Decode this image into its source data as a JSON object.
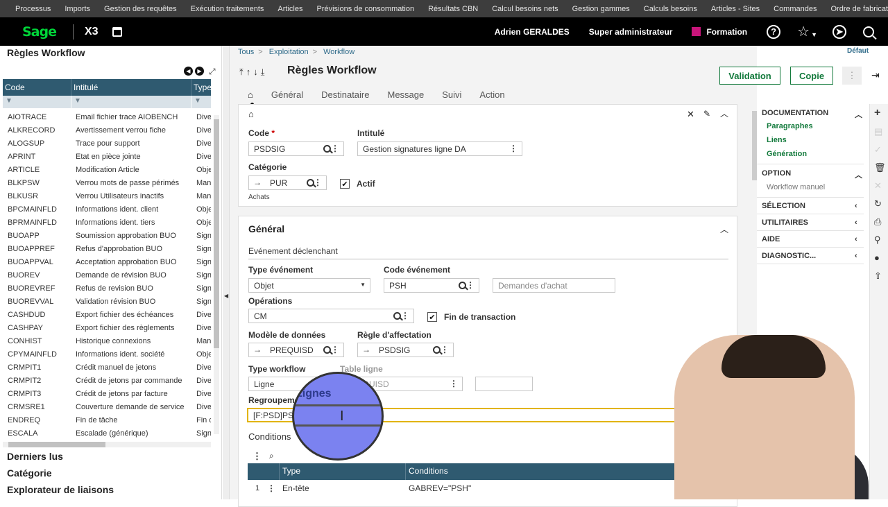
{
  "topnav": [
    "Processus",
    "Imports",
    "Gestion des requêtes",
    "Exécution traitements",
    "Articles",
    "Prévisions de consommation",
    "Résultats CBN",
    "Calcul besoins nets",
    "Gestion gammes",
    "Calculs besoins",
    "Articles - Sites",
    "Commandes",
    "Ordre de fabrication"
  ],
  "appbar": {
    "logo": "Sage",
    "product": "X3",
    "user": "Adrien GERALDES",
    "role": "Super administrateur",
    "folder": "Formation",
    "help": "?"
  },
  "left": {
    "title": "Règles Workflow",
    "columns": [
      "Code",
      "Intitulé",
      "Type"
    ],
    "rows": [
      [
        "AIOTRACE",
        "Email fichier trace AIOBENCH",
        "Diver"
      ],
      [
        "ALKRECORD",
        "Avertissement verrou fiche",
        "Diver"
      ],
      [
        "ALOGSUP",
        "Trace pour support",
        "Diver"
      ],
      [
        "APRINT",
        "Etat en pièce jointe",
        "Diver"
      ],
      [
        "ARTICLE",
        "Modification Article",
        "Obje"
      ],
      [
        "BLKPSW",
        "Verrou mots de passe périmés",
        "Manu"
      ],
      [
        "BLKUSR",
        "Verrou Utilisateurs inactifs",
        "Manu"
      ],
      [
        "BPCMAINFLD",
        "Informations ident. client",
        "Obje"
      ],
      [
        "BPRMAINFLD",
        "Informations ident. tiers",
        "Obje"
      ],
      [
        "BUOAPP",
        "Soumission approbation BUO",
        "Signa"
      ],
      [
        "BUOAPPREF",
        "Refus d'approbation BUO",
        "Signa"
      ],
      [
        "BUOAPPVAL",
        "Acceptation approbation BUO",
        "Signa"
      ],
      [
        "BUOREV",
        "Demande de révision BUO",
        "Signa"
      ],
      [
        "BUOREVREF",
        "Refus de revision BUO",
        "Signa"
      ],
      [
        "BUOREVVAL",
        "Validation révision BUO",
        "Signa"
      ],
      [
        "CASHDUD",
        "Export fichier des échéances",
        "Diver"
      ],
      [
        "CASHPAY",
        "Export fichier des règlements",
        "Diver"
      ],
      [
        "CONHIST",
        "Historique connexions",
        "Manu"
      ],
      [
        "CPYMAINFLD",
        "Informations ident. société",
        "Obje"
      ],
      [
        "CRMPIT1",
        "Crédit manuel de jetons",
        "Diver"
      ],
      [
        "CRMPIT2",
        "Crédit de jetons par commande",
        "Diver"
      ],
      [
        "CRMPIT3",
        "Crédit de jetons par facture",
        "Diver"
      ],
      [
        "CRMSRE1",
        "Couverture demande de service",
        "Diver"
      ],
      [
        "ENDREQ",
        "Fin de tâche",
        "Fin d"
      ],
      [
        "ESCALA",
        "Escalade (générique)",
        "Signa"
      ]
    ],
    "sections": [
      "Derniers lus",
      "Catégorie",
      "Explorateur de liaisons"
    ]
  },
  "breadcrumb": [
    "Tous",
    "Exploitation",
    "Workflow"
  ],
  "default_label": "Défaut",
  "page_title": "Règles Workflow",
  "buttons": {
    "validation": "Validation",
    "copie": "Copie"
  },
  "tabs": [
    "Général",
    "Destinataire",
    "Message",
    "Suivi",
    "Action"
  ],
  "header": {
    "code_label": "Code",
    "code": "PSDSIG",
    "intitule_label": "Intitulé",
    "intitule": "Gestion signatures ligne DA",
    "categorie_label": "Catégorie",
    "categorie": "PUR",
    "categorie_desc": "Achats",
    "actif_label": "Actif"
  },
  "general": {
    "title": "Général",
    "subtitle": "Evénement déclenchant",
    "type_evt_label": "Type événement",
    "type_evt": "Objet",
    "code_evt_label": "Code événement",
    "code_evt": "PSH",
    "code_evt_desc": "Demandes d'achat",
    "operations_label": "Opérations",
    "operations": "CM",
    "fin_transaction_label": "Fin de transaction",
    "modele_label": "Modèle de données",
    "modele": "PREQUISD",
    "regle_label": "Règle d'affectation",
    "regle": "PSDSIG",
    "type_wf_label": "Type workflow",
    "type_wf": "Ligne",
    "table_ligne_label": "Table ligne",
    "table_ligne": "PREQUISD",
    "regroupement_label": "Regroupement",
    "regroupement": "[F:PSD]PSHNUM",
    "conditions_label": "Conditions",
    "lignes_label": "Lignes"
  },
  "conditions": {
    "columns": [
      "Type",
      "Conditions"
    ],
    "row": [
      "1",
      "En-tête",
      "GABREV=\"PSH\""
    ]
  },
  "rightpanel": {
    "documentation": "DOCUMENTATION",
    "links": [
      "Paragraphes",
      "Liens",
      "Génération"
    ],
    "option": "OPTION",
    "option_item": "Workflow manuel",
    "selection": "SÉLECTION",
    "utilitaires": "UTILITAIRES",
    "aide": "AIDE",
    "diagnostic": "DIAGNOSTIC..."
  }
}
